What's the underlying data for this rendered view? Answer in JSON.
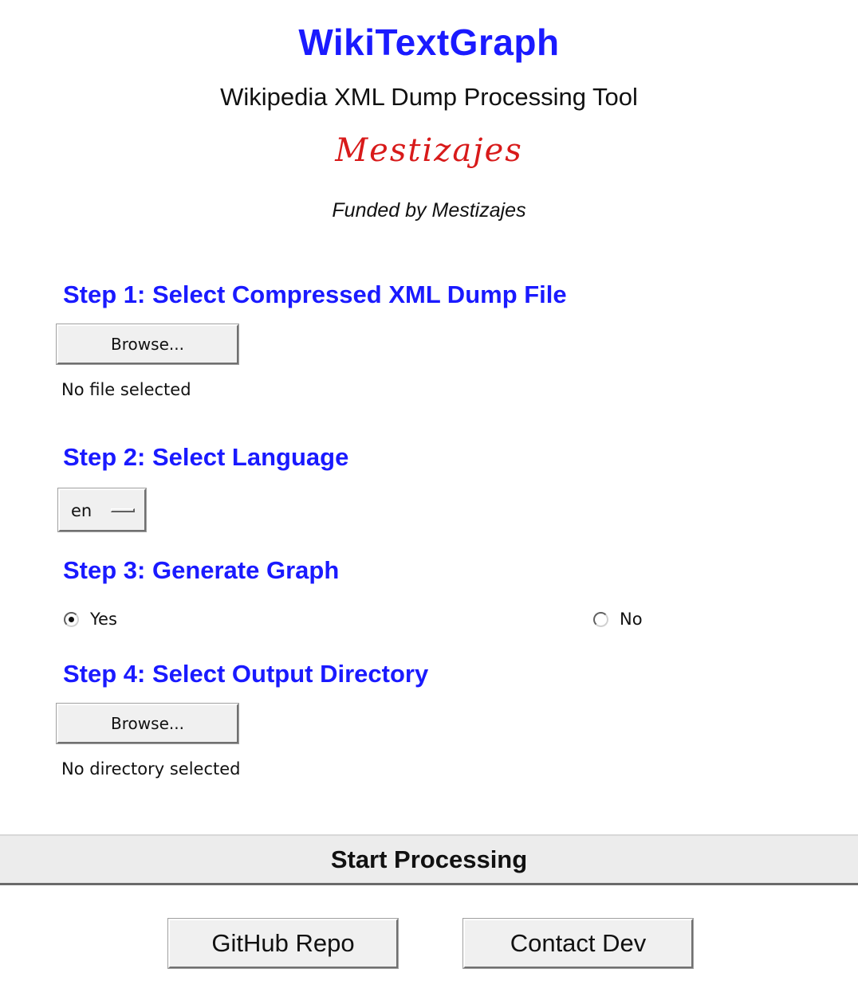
{
  "header": {
    "title": "WikiTextGraph",
    "subtitle": "Wikipedia XML Dump Processing Tool",
    "logo_text": "Mestizajes",
    "funded_by": "Funded by Mestizajes"
  },
  "step1": {
    "heading": "Step 1: Select Compressed XML Dump File",
    "browse_label": "Browse...",
    "status": "No file selected"
  },
  "step2": {
    "heading": "Step 2: Select Language",
    "selected_language": "en"
  },
  "step3": {
    "heading": "Step 3: Generate Graph",
    "options": [
      {
        "label": "Yes",
        "checked": true
      },
      {
        "label": "No",
        "checked": false
      }
    ]
  },
  "step4": {
    "heading": "Step 4: Select Output Directory",
    "browse_label": "Browse...",
    "status": "No directory selected"
  },
  "actions": {
    "start_label": "Start Processing",
    "github_label": "GitHub Repo",
    "contact_label": "Contact Dev"
  },
  "colors": {
    "accent": "#1a1aff",
    "logo": "#d81a1a"
  }
}
